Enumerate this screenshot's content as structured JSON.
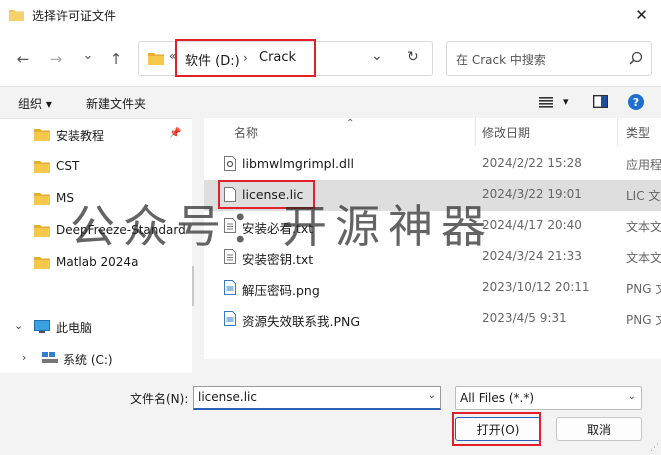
{
  "window": {
    "title": "选择许可证文件",
    "close_glyph": "✕"
  },
  "navbar": {
    "back_glyph": "←",
    "forward_glyph": "→",
    "recent_glyph": "⌄",
    "up_glyph": "↑",
    "breadcrumb_prefix": "«",
    "breadcrumb": [
      "软件 (D:)",
      "Crack"
    ],
    "separator": "›",
    "dropdown_glyph": "⌄",
    "refresh_glyph": "↻",
    "search_placeholder": "在 Crack 中搜索"
  },
  "toolbar": {
    "organize": "组织",
    "new_folder": "新建文件夹",
    "dropdown_glyph": "▾",
    "help_glyph": "?"
  },
  "sidebar": {
    "pin_glyph": "📌",
    "items": [
      {
        "label": "安装教程",
        "pinned": true
      },
      {
        "label": "CST"
      },
      {
        "label": "MS"
      },
      {
        "label": "DeepFreeze-Standard"
      },
      {
        "label": "Matlab 2024a"
      }
    ],
    "this_pc": {
      "label": "此电脑",
      "expand_glyph": "⌄"
    },
    "system_drive": {
      "label": "系统 (C:)",
      "expand_glyph": "›"
    }
  },
  "filelist": {
    "sort_glyph": "⌃",
    "columns": {
      "name": "名称",
      "date": "修改日期",
      "type": "类型"
    },
    "rows": [
      {
        "name": "libmwlmgrimpl.dll",
        "date": "2024/2/22 15:28",
        "type": "应用程",
        "icon": "dll-icon"
      },
      {
        "name": "license.lic",
        "date": "2024/3/22 19:01",
        "type": "LIC 文",
        "icon": "file-icon",
        "selected": true
      },
      {
        "name": "安装必看.txt",
        "date": "2024/4/17 20:40",
        "type": "文本文",
        "icon": "text-file-icon"
      },
      {
        "name": "安装密钥.txt",
        "date": "2024/3/24 21:33",
        "type": "文本文",
        "icon": "text-file-icon"
      },
      {
        "name": "解压密码.png",
        "date": "2023/10/12 20:11",
        "type": "PNG 文",
        "icon": "image-file-icon"
      },
      {
        "name": "资源失效联系我.PNG",
        "date": "2023/4/5 9:31",
        "type": "PNG 文",
        "icon": "image-file-icon"
      }
    ]
  },
  "bottom": {
    "filename_label": "文件名(N):",
    "filename_value": "license.lic",
    "dropdown_glyph": "⌄",
    "filter": "All Files (*.*)",
    "open_button": "打开(O)",
    "cancel_button": "取消",
    "resize_glyph": "⋰"
  },
  "watermark": "公众号：开源神器",
  "colors": {
    "accent": "#2b5fb3",
    "highlight": "#e0202a",
    "folder": "#f2c14e",
    "selection": "#dedede"
  }
}
